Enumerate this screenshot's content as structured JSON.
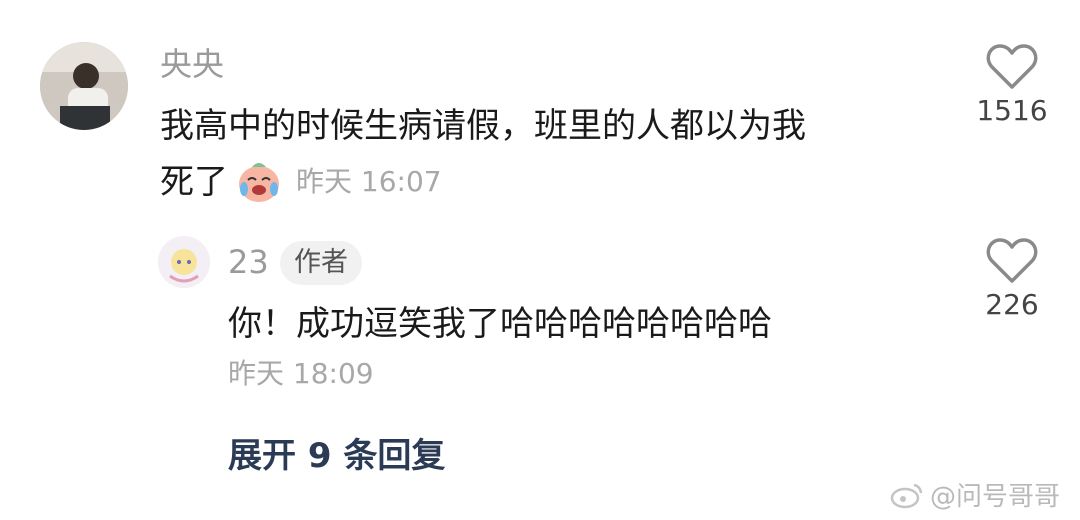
{
  "comment": {
    "username": "央央",
    "line1": "我高中的时候生病请假，班里的人都以为我",
    "line2": "死了",
    "emoji": "crying-laughing-emoji",
    "time": "昨天 16:07",
    "likes": "1516"
  },
  "reply": {
    "username": "23",
    "badge": "作者",
    "text": "你！成功逗笑我了哈哈哈哈哈哈哈哈",
    "time": "昨天 18:09",
    "likes": "226"
  },
  "expand_label": "展开 9 条回复",
  "watermark": "@问号哥哥",
  "colors": {
    "expand": "#2b3a55",
    "username": "#9a9a9a",
    "time": "#a8a8a8"
  }
}
